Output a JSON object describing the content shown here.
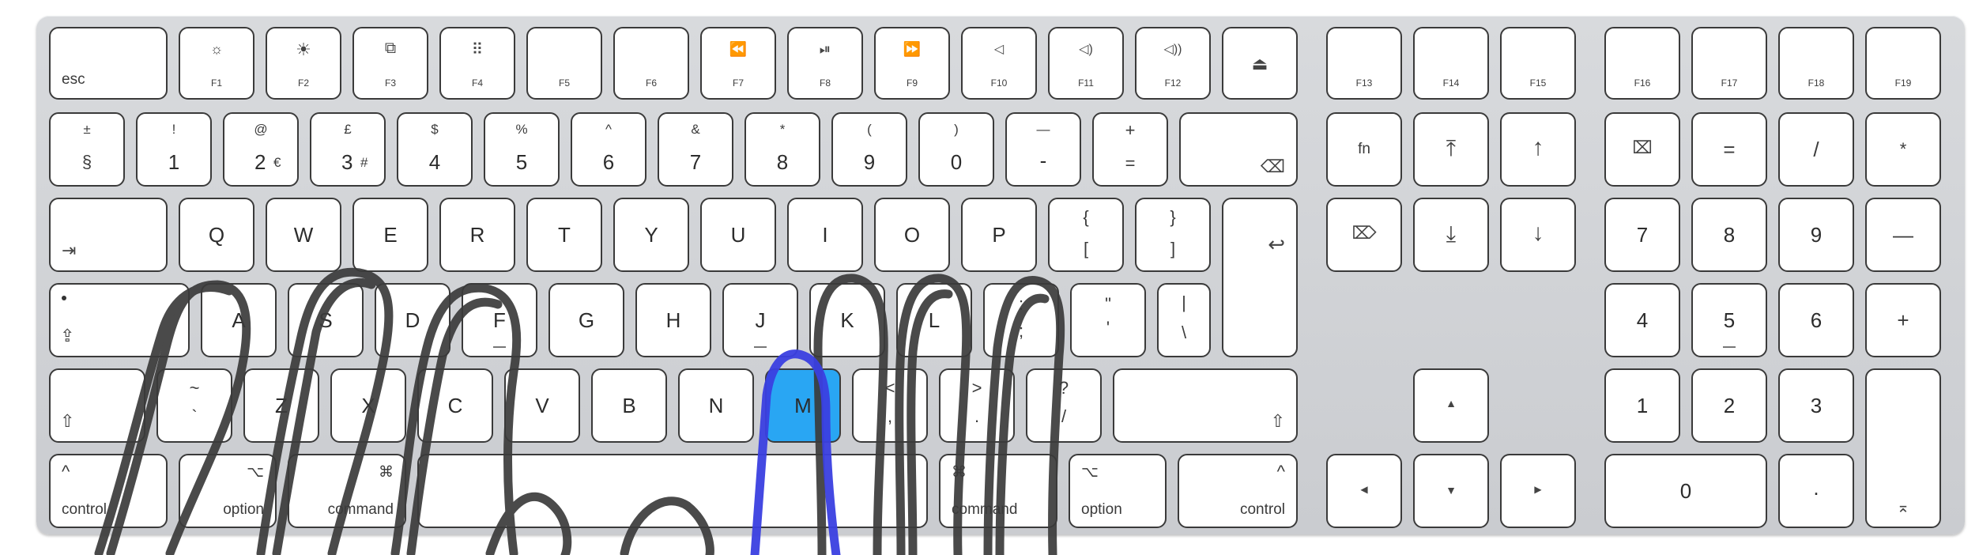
{
  "colors": {
    "keyboard": "#d2d4d8",
    "key": "#ffffff",
    "key_border": "#3a3a3a",
    "highlight": "#29a6f3",
    "drawing": "#3b3b3b",
    "finger": "#3a3fe0"
  },
  "row_fn": {
    "esc": "esc",
    "f1": "F1",
    "f2": "F2",
    "f3": "F3",
    "f4": "F4",
    "f5": "F5",
    "f6": "F6",
    "f7": "F7",
    "f8": "F8",
    "f9": "F9",
    "f10": "F10",
    "f11": "F11",
    "f12": "F12",
    "f13": "F13",
    "f14": "F14",
    "f15": "F15",
    "f16": "F16",
    "f17": "F17",
    "f18": "F18",
    "f19": "F19"
  },
  "row_num": {
    "section_top": "±",
    "section_bot": "§",
    "k1_top": "!",
    "k1": "1",
    "k2_top": "@",
    "k2": "2",
    "k2_alt": "€",
    "k3_top": "£",
    "k3": "3",
    "k3_alt": "#",
    "k4_top": "$",
    "k4": "4",
    "k5_top": "%",
    "k5": "5",
    "k6_top": "^",
    "k6": "6",
    "k7_top": "&",
    "k7": "7",
    "k8_top": "*",
    "k8": "8",
    "k9_top": "(",
    "k9": "9",
    "k0_top": ")",
    "k0": "0",
    "minus_top": "—",
    "minus": "-",
    "plus_top": "+",
    "plus": "=",
    "fn": "fn",
    "np_eq": "=",
    "np_div": "/",
    "np_mul": "*"
  },
  "row_q": {
    "q": "Q",
    "w": "W",
    "e": "E",
    "r": "R",
    "t": "T",
    "y": "Y",
    "u": "U",
    "i": "I",
    "o": "O",
    "p": "P",
    "lbrace": "{",
    "lbracket": "[",
    "rbrace": "}",
    "rbracket": "]",
    "np7": "7",
    "np8": "8",
    "np9": "9",
    "np_minus": "—"
  },
  "row_a": {
    "a": "A",
    "s": "S",
    "d": "D",
    "f": "F",
    "g": "G",
    "h": "H",
    "j": "J",
    "k": "K",
    "l": "L",
    "colon": ":",
    "semicolon": ";",
    "quote": "\"",
    "apos": "'",
    "pipe": "|",
    "backslash": "\\",
    "np4": "4",
    "np5": "5",
    "np6": "6",
    "np_plus": "+"
  },
  "row_z": {
    "tilde": "~",
    "grave": "`",
    "z": "Z",
    "x": "X",
    "c": "C",
    "v": "V",
    "b": "B",
    "n": "N",
    "m": "M",
    "lt": "<",
    "comma": ",",
    "gt": ">",
    "period": ".",
    "question": "?",
    "slash": "/",
    "np1": "1",
    "np2": "2",
    "np3": "3"
  },
  "row_bottom": {
    "control": "control",
    "option": "option",
    "command": "command",
    "command_r": "command",
    "option_r": "option",
    "control_r": "control",
    "caret": "^",
    "cmd_sym": "⌘",
    "opt_sym": "⌥",
    "np0": "0",
    "np_dot": "."
  },
  "icons": {
    "brightness-down-icon": "☼",
    "brightness-up-icon": "☀",
    "mission-control-icon": "⧉",
    "launchpad-icon": "⠿",
    "rewind-icon": "⏪",
    "play-pause-icon": "⏯",
    "fast-forward-icon": "⏩",
    "mute-icon": "◁",
    "volume-down-icon": "◁)",
    "volume-up-icon": "◁))",
    "eject-icon": "⏏",
    "delete-icon": "⌫",
    "forward-delete-icon": "⌦",
    "clear-icon": "⌧",
    "tab-icon": "⇥",
    "return-icon": "↩",
    "caps-lock-icon": "⇪",
    "shift-icon": "⇧",
    "home-icon": "⤒",
    "end-icon": "⤓",
    "page-up-icon": "↑",
    "page-down-icon": "↓",
    "arrow-up-icon": "▲",
    "arrow-left-icon": "◀",
    "arrow-down-icon": "▼",
    "arrow-right-icon": "▶",
    "enter-icon": "⌅"
  }
}
